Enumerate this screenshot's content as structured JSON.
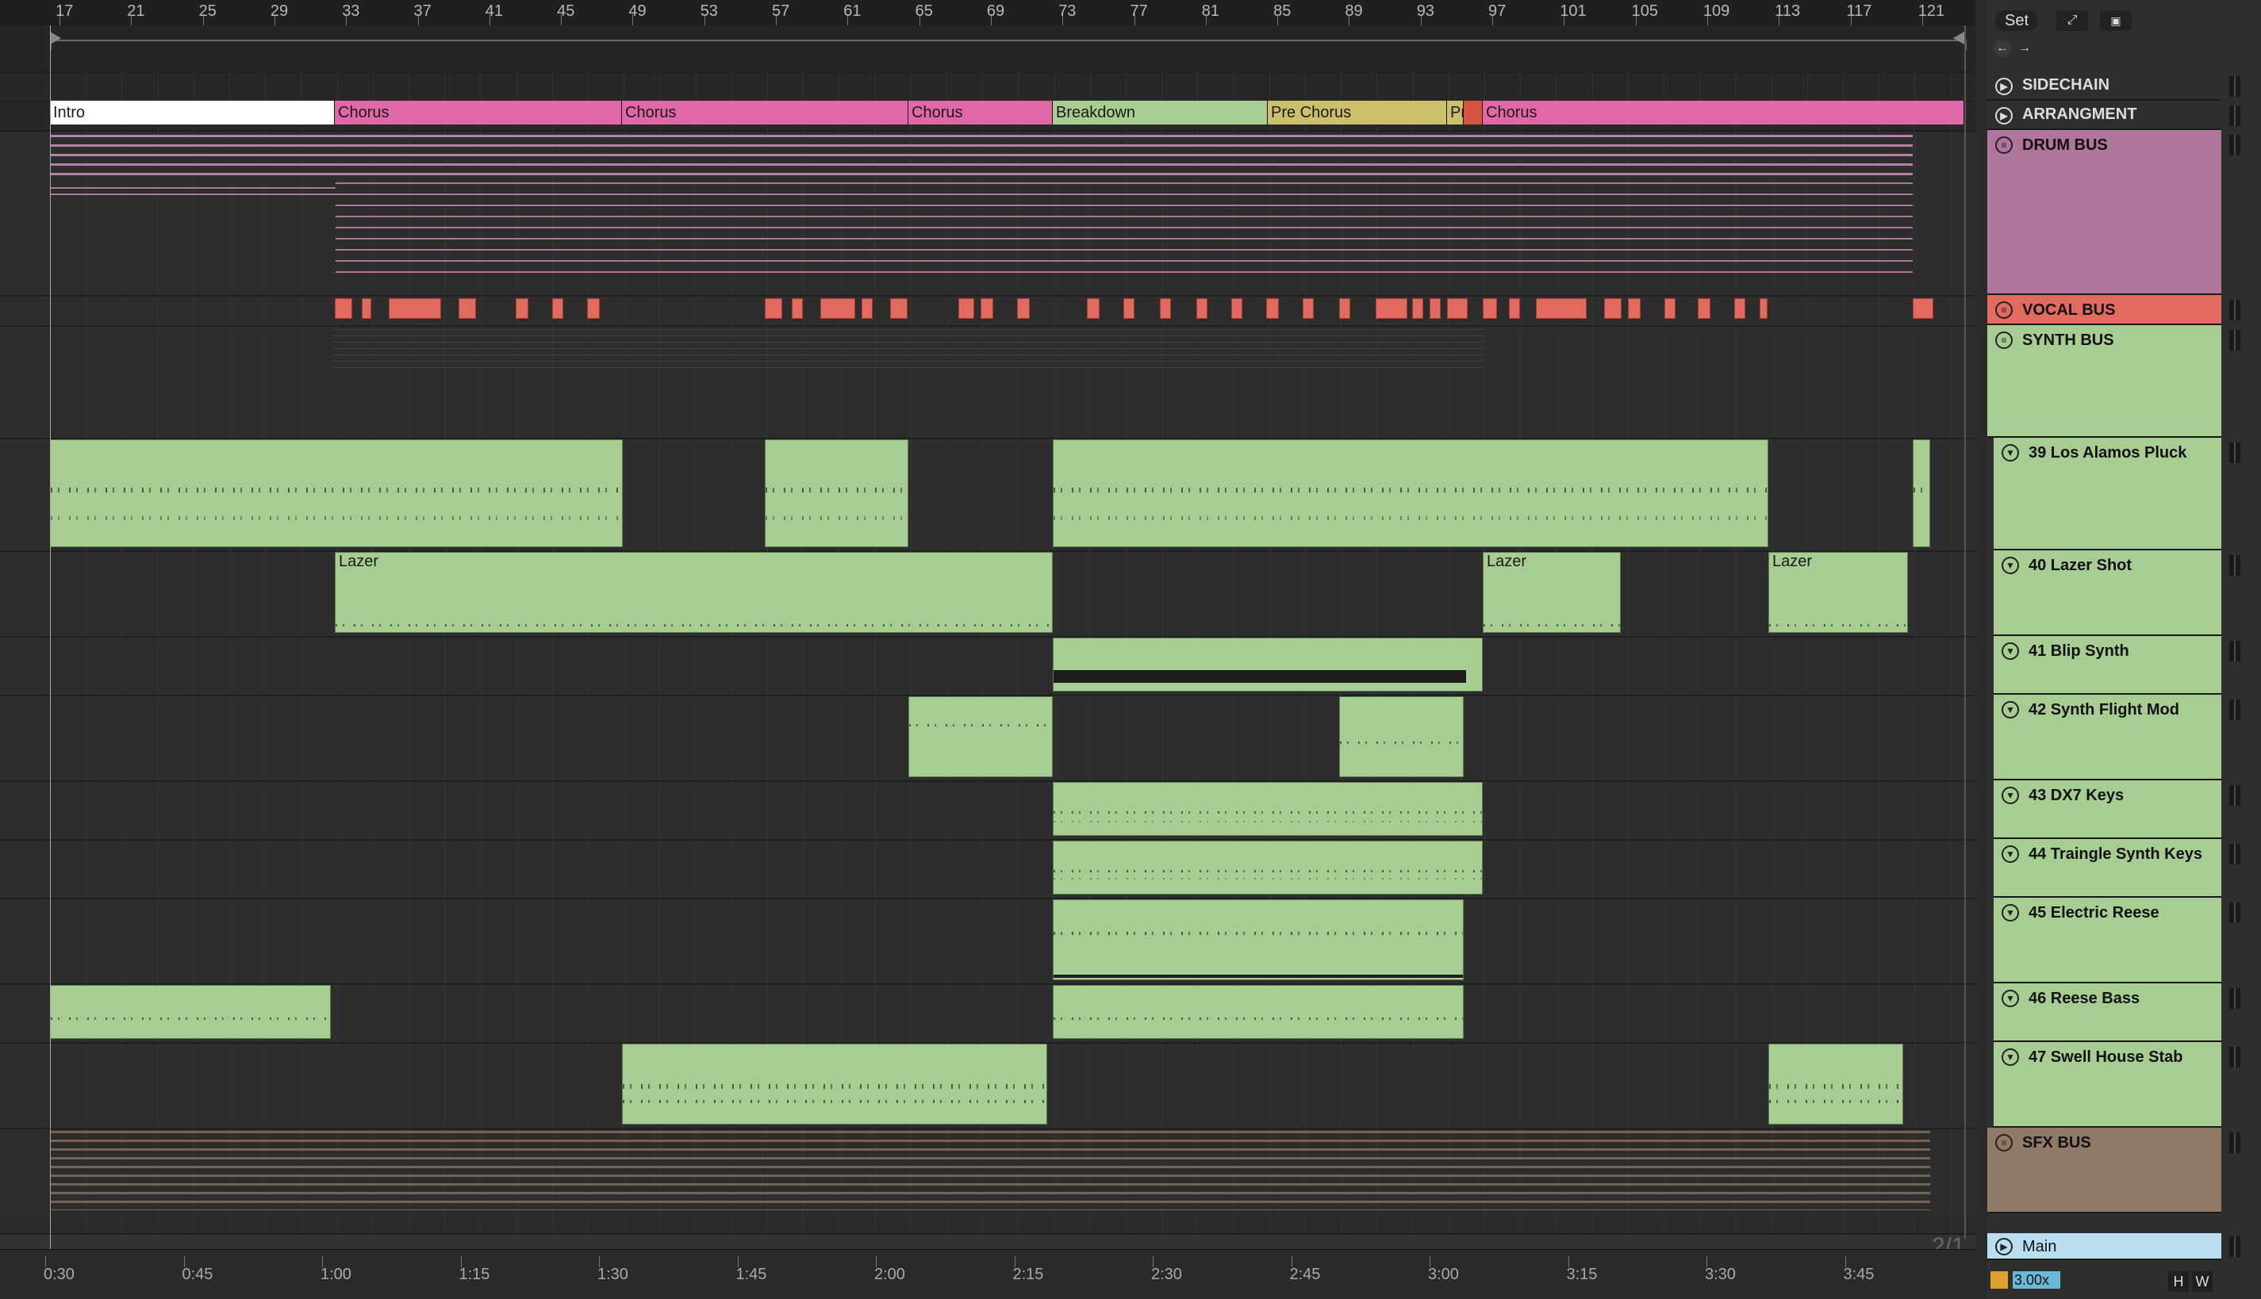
{
  "ruler": {
    "bars": [
      "17",
      "21",
      "25",
      "29",
      "33",
      "37",
      "41",
      "45",
      "49",
      "53",
      "57",
      "61",
      "65",
      "69",
      "73",
      "77",
      "81",
      "85",
      "89",
      "93",
      "97",
      "101",
      "105",
      "109",
      "113",
      "117",
      "121"
    ]
  },
  "locators": [
    {
      "label": "Intro",
      "color": "#ffffff"
    },
    {
      "label": "Chorus",
      "color": "#e267a6"
    },
    {
      "label": "Chorus",
      "color": "#e267a6"
    },
    {
      "label": "Chorus",
      "color": "#e267a6"
    },
    {
      "label": "Breakdown",
      "color": "#a7cd93"
    },
    {
      "label": "Pre Chorus",
      "color": "#cbc06b"
    },
    {
      "label": "Pr",
      "color": "#cbc06b"
    },
    {
      "label": "",
      "color": "#d6533f"
    },
    {
      "label": "Chorus",
      "color": "#e267a6"
    }
  ],
  "clips": {
    "lazer": "Lazer"
  },
  "topbar": {
    "set_label": "Set",
    "expand_icon": "expand-icon",
    "lock_icon": "lock-icon",
    "back_icon": "arrow-left-icon",
    "forward_icon": "arrow-right-icon"
  },
  "tracks": [
    {
      "name": "SIDECHAIN",
      "color": "#2e2e2e",
      "type": "return",
      "text_color": "#dddddd"
    },
    {
      "name": "ARRANGMENT",
      "color": "#2e2e2e",
      "type": "return",
      "text_color": "#dddddd"
    },
    {
      "name": "DRUM BUS",
      "color": "#b0759a",
      "type": "group"
    },
    {
      "name": "VOCAL BUS",
      "color": "#e26a5f",
      "type": "group"
    },
    {
      "name": "SYNTH BUS",
      "color": "#a7cd93",
      "type": "group"
    },
    {
      "name": "39 Los Alamos Pluck",
      "color": "#a7cd93",
      "type": "midi"
    },
    {
      "name": "40 Lazer Shot",
      "color": "#a7cd93",
      "type": "midi"
    },
    {
      "name": "41 Blip Synth",
      "color": "#a7cd93",
      "type": "midi"
    },
    {
      "name": "42 Synth Flight Mod",
      "color": "#a7cd93",
      "type": "midi"
    },
    {
      "name": "43 DX7 Keys",
      "color": "#a7cd93",
      "type": "midi"
    },
    {
      "name": "44 Traingle Synth Keys",
      "color": "#a7cd93",
      "type": "midi"
    },
    {
      "name": "45 Electric Reese",
      "color": "#a7cd93",
      "type": "midi"
    },
    {
      "name": "46 Reese Bass",
      "color": "#a7cd93",
      "type": "midi"
    },
    {
      "name": "47 Swell House Stab",
      "color": "#a7cd93",
      "type": "midi"
    },
    {
      "name": "SFX BUS",
      "color": "#8f7a67",
      "type": "group"
    }
  ],
  "main_track": {
    "name": "Main",
    "color": "#b9dff0"
  },
  "time_signature": "2/1",
  "zoom": "3.00x",
  "hw_buttons": {
    "h": "H",
    "w": "W"
  },
  "timeline": [
    "0:30",
    "0:45",
    "1:00",
    "1:15",
    "1:30",
    "1:45",
    "2:00",
    "2:15",
    "2:30",
    "2:45",
    "3:00",
    "3:15",
    "3:30",
    "3:45"
  ]
}
